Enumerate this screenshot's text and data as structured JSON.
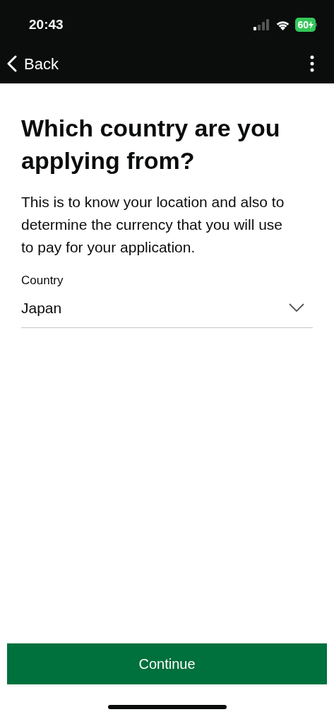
{
  "status_bar": {
    "time": "20:43",
    "battery": "60"
  },
  "nav": {
    "back": "Back"
  },
  "title": "Which country are you applying from?",
  "description": "This is to know your location and also to determine the currency that you will use to pay for your application.",
  "country_field": {
    "label": "Country",
    "value": "Japan"
  },
  "continue_button": "Continue"
}
